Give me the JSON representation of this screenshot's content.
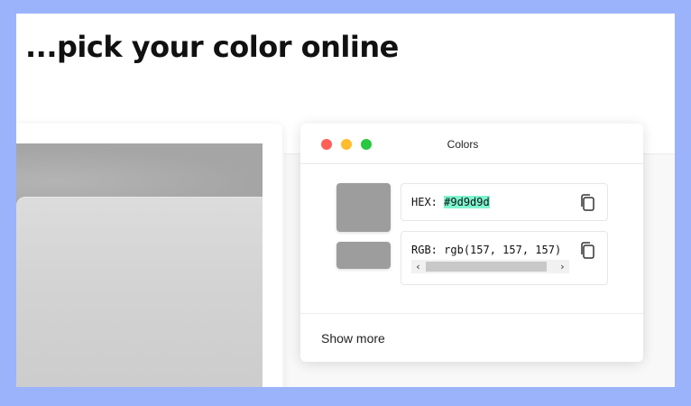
{
  "headline": "...pick your color online",
  "panel": {
    "title": "Colors",
    "window_controls": [
      "close",
      "minimize",
      "zoom"
    ],
    "swatch_color": "#9d9d9d",
    "hex": {
      "label": "HEX:",
      "value": "#9d9d9d",
      "icon": "copy-icon"
    },
    "rgb": {
      "label": "RGB:",
      "value": "rgb(157, 157, 157)",
      "icon": "copy-icon"
    },
    "show_more_label": "Show more"
  },
  "colors": {
    "background": "#9ab3fb",
    "highlight": "#7ff5cf",
    "close": "#fe5f57",
    "minimize": "#febc2e",
    "zoom": "#28c840"
  }
}
